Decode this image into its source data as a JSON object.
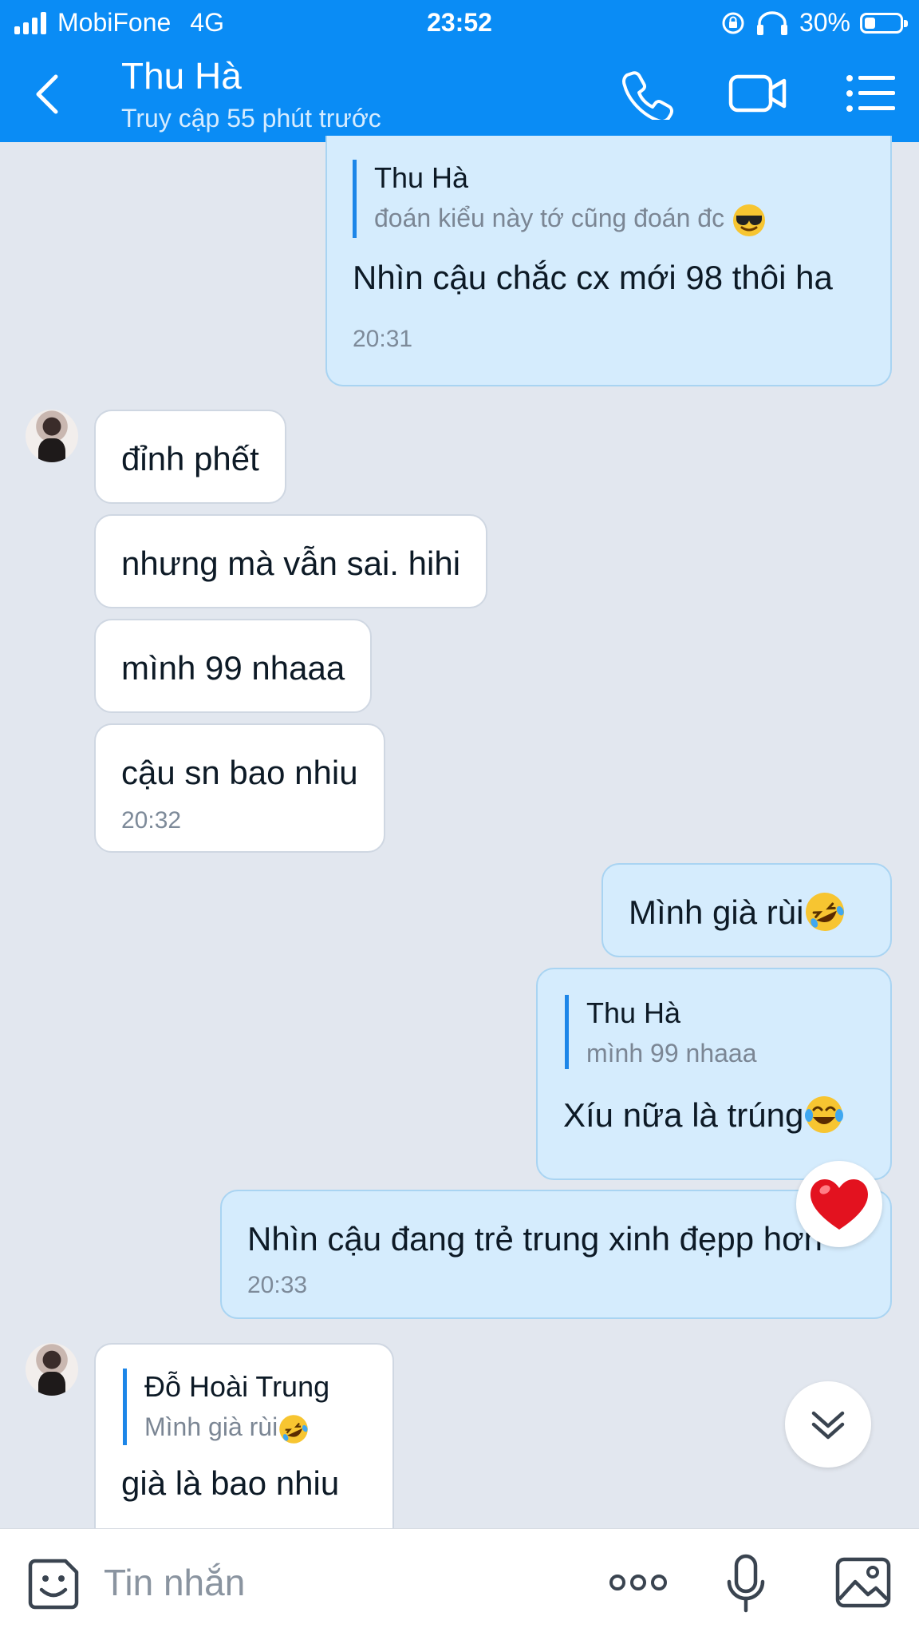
{
  "status_bar": {
    "carrier": "MobiFone",
    "network": "4G",
    "time": "23:52",
    "battery": "30%",
    "battery_level": 0.3
  },
  "header": {
    "title": "Thu Hà",
    "subtitle": "Truy cập 55 phút trước"
  },
  "messages": {
    "m1": {
      "quote_name": "Thu Hà",
      "quote_text": "đoán kiểu này tớ cũng đoán đc",
      "text": "Nhìn cậu chắc cx mới 98 thôi ha",
      "time": "20:31"
    },
    "m2": {
      "text": "đỉnh phết"
    },
    "m3": {
      "text": "nhưng mà vẫn sai. hihi"
    },
    "m4": {
      "text": "mình 99 nhaaa"
    },
    "m5": {
      "text": "cậu sn bao nhiu",
      "time": "20:32"
    },
    "m6": {
      "text": "Mình già rùi"
    },
    "m7": {
      "quote_name": "Thu Hà",
      "quote_text": "mình 99 nhaaa",
      "text": "Xíu nữa là trúng"
    },
    "m8": {
      "text": "Nhìn cậu đang trẻ trung xinh đẹpp hơn",
      "time": "20:33"
    },
    "m9": {
      "quote_name": "Đỗ Hoài Trung",
      "quote_text": "Mình già rùi",
      "text": "già là bao nhiu"
    }
  },
  "composer": {
    "placeholder": "Tin nhắn"
  },
  "icons": {
    "back": "chevron-left-icon",
    "call": "phone-icon",
    "video": "video-camera-icon",
    "menu": "list-menu-icon",
    "sticker": "sticker-smile-icon",
    "more": "more-dots-icon",
    "mic": "microphone-icon",
    "image": "image-icon"
  },
  "colors": {
    "header": "#0a8cf5",
    "outgoing_bubble": "#d5ecfd",
    "incoming_bubble": "#ffffff",
    "background": "#e2e7ef",
    "reaction_heart": "#e3121f"
  }
}
